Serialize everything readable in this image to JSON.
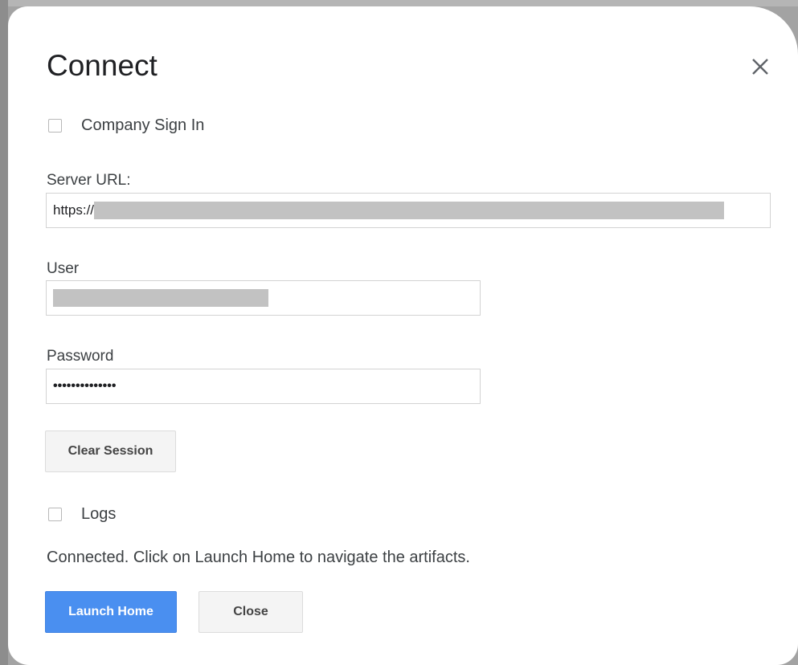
{
  "dialog": {
    "title": "Connect",
    "close_icon": "close-icon"
  },
  "company_sign_in": {
    "label": "Company Sign In",
    "checked": false
  },
  "server_url": {
    "label": "Server URL:",
    "value": "https://"
  },
  "user": {
    "label": "User",
    "value": ""
  },
  "password": {
    "label": "Password",
    "value": "••••••••••••••"
  },
  "buttons": {
    "clear_session": "Clear Session",
    "launch_home": "Launch Home",
    "close": "Close"
  },
  "logs": {
    "label": "Logs",
    "checked": false
  },
  "status": {
    "message": "Connected. Click on Launch Home to navigate the artifacts."
  },
  "colors": {
    "primary_button": "#4a8ff0",
    "secondary_button": "#f4f4f4",
    "redaction": "#c2c2c2"
  }
}
